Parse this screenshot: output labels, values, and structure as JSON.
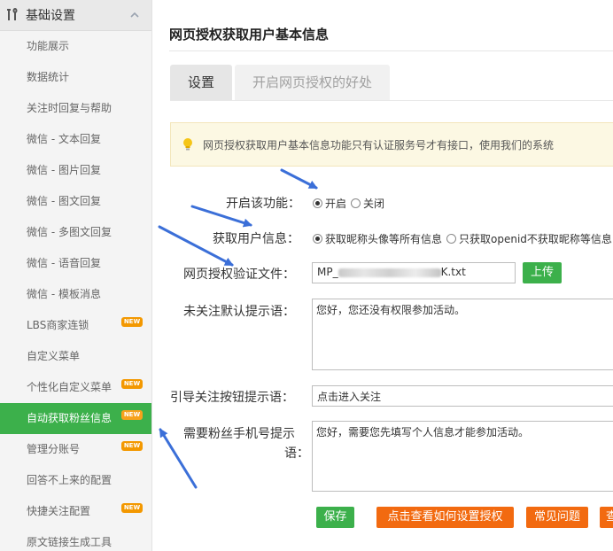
{
  "sidebar": {
    "section_title": "基础设置",
    "items": [
      {
        "label": "功能展示",
        "new": false,
        "active": false
      },
      {
        "label": "数据统计",
        "new": false,
        "active": false
      },
      {
        "label": "关注时回复与帮助",
        "new": false,
        "active": false
      },
      {
        "label": "微信 - 文本回复",
        "new": false,
        "active": false
      },
      {
        "label": "微信 - 图片回复",
        "new": false,
        "active": false
      },
      {
        "label": "微信 - 图文回复",
        "new": false,
        "active": false
      },
      {
        "label": "微信 - 多图文回复",
        "new": false,
        "active": false
      },
      {
        "label": "微信 - 语音回复",
        "new": false,
        "active": false
      },
      {
        "label": "微信 - 模板消息",
        "new": false,
        "active": false
      },
      {
        "label": "LBS商家连锁",
        "new": true,
        "active": false
      },
      {
        "label": "自定义菜单",
        "new": false,
        "active": false
      },
      {
        "label": "个性化自定义菜单",
        "new": true,
        "active": false
      },
      {
        "label": "自动获取粉丝信息",
        "new": true,
        "active": true
      },
      {
        "label": "管理分账号",
        "new": true,
        "active": false
      },
      {
        "label": "回答不上来的配置",
        "new": false,
        "active": false
      },
      {
        "label": "快捷关注配置",
        "new": true,
        "active": false
      },
      {
        "label": "原文链接生成工具",
        "new": false,
        "active": false
      }
    ],
    "new_badge_text": "NEW"
  },
  "page": {
    "title": "网页授权获取用户基本信息",
    "tabs": [
      {
        "label": "设置",
        "active": true
      },
      {
        "label": "开启网页授权的好处",
        "active": false
      }
    ],
    "notice": "网页授权获取用户基本信息功能只有认证服务号才有接口，使用我们的系统"
  },
  "form": {
    "enable": {
      "label": "开启该功能：",
      "options": [
        {
          "label": "开启",
          "checked": true
        },
        {
          "label": "关闭",
          "checked": false
        }
      ]
    },
    "userinfo": {
      "label": "获取用户信息：",
      "options": [
        {
          "label": "获取昵称头像等所有信息",
          "checked": true
        },
        {
          "label": "只获取openid不获取昵称等信息",
          "checked": false
        }
      ]
    },
    "verify_file": {
      "label": "网页授权验证文件：",
      "value_prefix": "MP_",
      "value_suffix": "K.txt",
      "upload_label": "上传"
    },
    "default_tip": {
      "label": "未关注默认提示语：",
      "value": "您好，您还没有权限参加活动。"
    },
    "follow_tip": {
      "label": "引导关注按钮提示语：",
      "value": "点击进入关注"
    },
    "phone_tip": {
      "label_line1": "需要粉丝手机号提示",
      "label_line2": "语：",
      "value": "您好，需要您先填写个人信息才能参加活动。"
    }
  },
  "actions": {
    "save": "保存",
    "howto": "点击查看如何设置授权",
    "faq": "常见问题",
    "more": "查"
  },
  "colors": {
    "green": "#3cb04b",
    "orange": "#f26a10",
    "new_badge": "#f39800",
    "arrow": "#3b6fd8"
  }
}
